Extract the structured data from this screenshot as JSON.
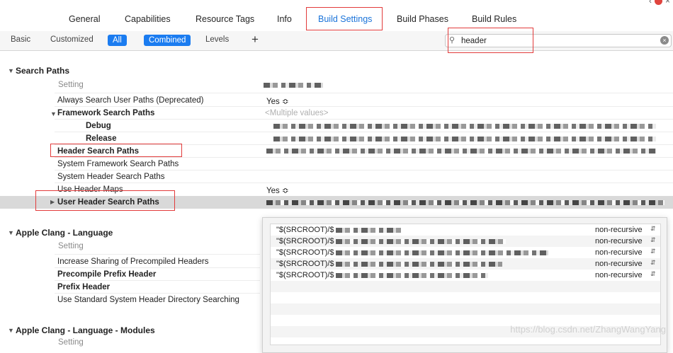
{
  "tabs": [
    "General",
    "Capabilities",
    "Resource Tags",
    "Info",
    "Build Settings",
    "Build Phases",
    "Build Rules"
  ],
  "active_tab": "Build Settings",
  "filter": {
    "basic": "Basic",
    "customized": "Customized",
    "all": "All",
    "combined": "Combined",
    "levels": "Levels",
    "add": "+"
  },
  "search": {
    "value": "header"
  },
  "sections": {
    "search_paths": {
      "title": "Search Paths",
      "setting_header": "Setting",
      "always_search": {
        "label": "Always Search User Paths (Deprecated)",
        "value": "Yes ≎"
      },
      "framework": {
        "label": "Framework Search Paths",
        "value": "<Multiple values>"
      },
      "debug": "Debug",
      "release": "Release",
      "header_search": "Header Search Paths",
      "system_framework": "System Framework Search Paths",
      "system_header": "System Header Search Paths",
      "use_header_maps": {
        "label": "Use Header Maps",
        "value": "Yes ≎"
      },
      "user_header": "User Header Search Paths"
    },
    "clang_language": {
      "title": "Apple Clang - Language",
      "setting_header": "Setting",
      "increase_sharing": "Increase Sharing of Precompiled Headers",
      "precompile_prefix": "Precompile Prefix Header",
      "prefix_header": "Prefix Header",
      "use_standard": "Use Standard System Header Directory Searching"
    },
    "clang_modules": {
      "title": "Apple Clang - Language - Modules",
      "setting_header": "Setting"
    }
  },
  "popup": {
    "rows": [
      {
        "path": "\"$(SRCROOT)/$",
        "mode": "non-recursive"
      },
      {
        "path": "\"$(SRCROOT)/$",
        "mode": "non-recursive"
      },
      {
        "path": "\"$(SRCROOT)/$",
        "mode": "non-recursive"
      },
      {
        "path": "\"$(SRCROOT)/$",
        "mode": "non-recursive"
      },
      {
        "path": "\"$(SRCROOT)/$",
        "mode": "non-recursive"
      }
    ]
  },
  "watermark": "https://blog.csdn.net/ZhangWangYang",
  "colors": {
    "accent": "#1b7cf0",
    "highlight_box": "#e23b3b",
    "selected_row": "#d9d9d9"
  }
}
